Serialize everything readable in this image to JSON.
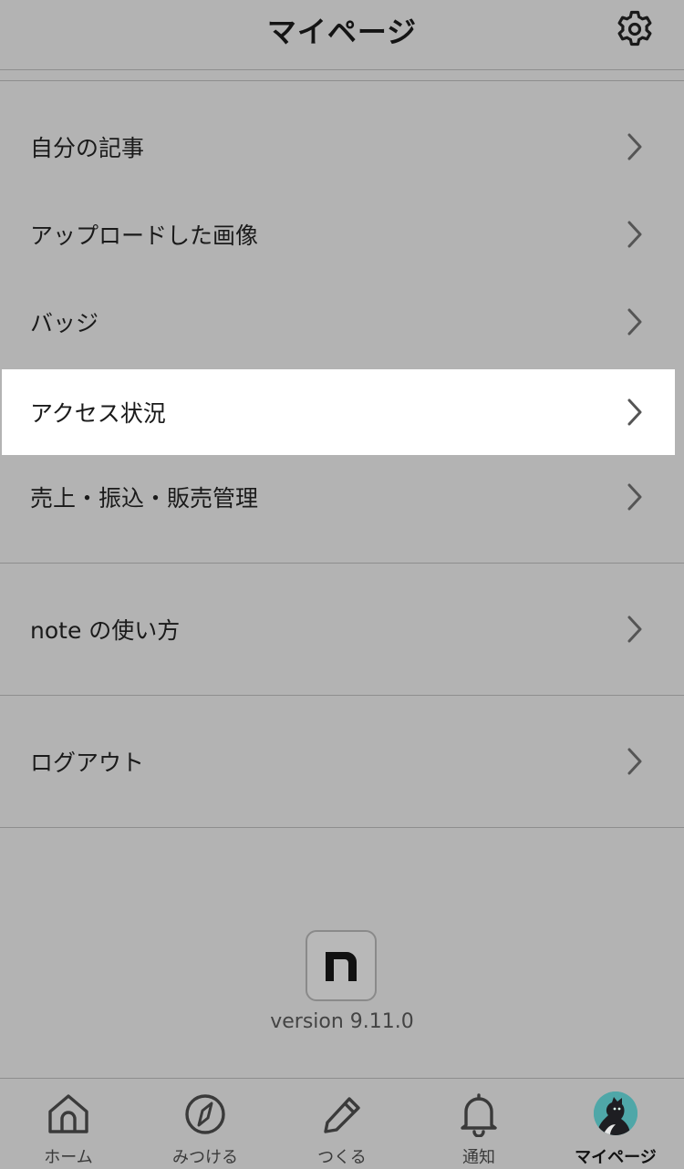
{
  "header": {
    "title": "マイページ",
    "settings_icon": "gear-icon"
  },
  "menu_sections": [
    {
      "items": [
        {
          "label": "自分の記事"
        },
        {
          "label": "アップロードした画像"
        },
        {
          "label": "バッジ"
        },
        {
          "label": "アクセス状況",
          "highlighted": true
        },
        {
          "label": "売上・振込・販売管理"
        }
      ]
    },
    {
      "items": [
        {
          "label": "note の使い方"
        }
      ]
    },
    {
      "items": [
        {
          "label": "ログアウト"
        }
      ]
    }
  ],
  "footer": {
    "logo_glyph": "n",
    "version": "version 9.11.0"
  },
  "tabbar": {
    "tabs": [
      {
        "label": "ホーム",
        "icon": "home-icon"
      },
      {
        "label": "みつける",
        "icon": "compass-icon"
      },
      {
        "label": "つくる",
        "icon": "pencil-icon"
      },
      {
        "label": "通知",
        "icon": "bell-icon"
      },
      {
        "label": "マイページ",
        "icon": "avatar",
        "active": true
      }
    ]
  },
  "colors": {
    "background": "#b3b3b3",
    "highlight": "#ffffff",
    "divider": "#8e8e8e",
    "avatar_bg": "#4fa7a8"
  }
}
